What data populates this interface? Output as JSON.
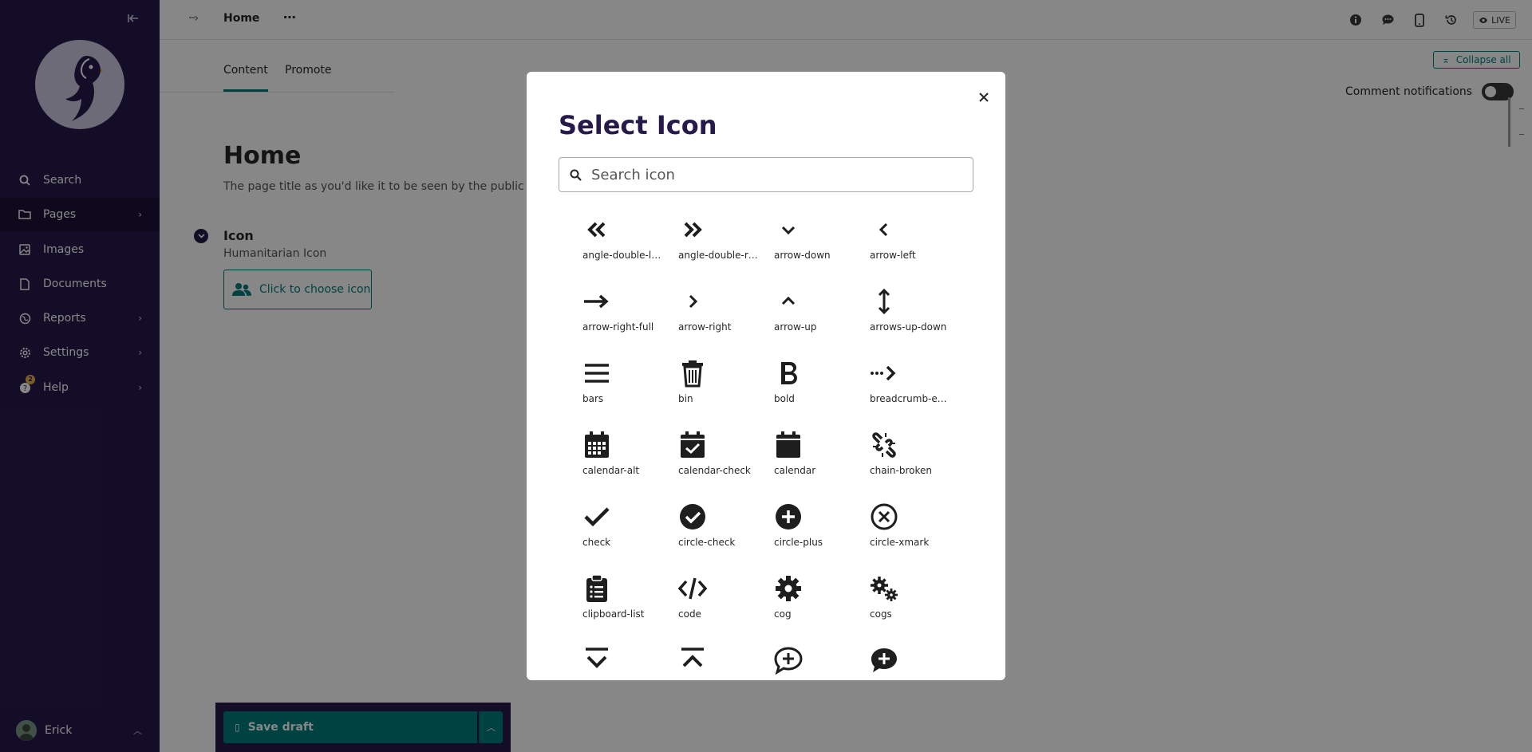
{
  "sidebar": {
    "collapse_icon": "collapse-left-icon",
    "items": [
      {
        "label": "Search",
        "icon": "search-icon",
        "has_children": false
      },
      {
        "label": "Pages",
        "icon": "folder-icon",
        "has_children": true
      },
      {
        "label": "Images",
        "icon": "image-icon",
        "has_children": false
      },
      {
        "label": "Documents",
        "icon": "doc-icon",
        "has_children": false
      },
      {
        "label": "Reports",
        "icon": "globe-icon",
        "has_children": true
      },
      {
        "label": "Settings",
        "icon": "cog-icon",
        "has_children": true
      },
      {
        "label": "Help",
        "icon": "help-icon",
        "has_children": true,
        "badge": "2"
      }
    ],
    "user": {
      "name": "Erick"
    }
  },
  "header": {
    "breadcrumb_title": "Home",
    "more": "⋯",
    "live_label": "LIVE"
  },
  "tabs": [
    {
      "label": "Content",
      "active": true
    },
    {
      "label": "Promote",
      "active": false
    }
  ],
  "panel": {
    "collapse_all_label": "Collapse all",
    "comment_notifications_label": "Comment notifications",
    "comment_notifications_on": false
  },
  "form": {
    "title_value": "Home",
    "title_help": "The page title as you'd like it to be seen by the public",
    "icon_field_label": "Icon",
    "icon_field_help": "Humanitarian Icon",
    "choose_icon_label": "Click to choose icon"
  },
  "footer": {
    "save_draft_label": "Save draft"
  },
  "modal": {
    "title": "Select Icon",
    "search_placeholder": "Search icon",
    "icons": [
      {
        "name": "angle-double-left",
        "label": "angle-double-left"
      },
      {
        "name": "angle-double-right",
        "label": "angle-double-ri…"
      },
      {
        "name": "arrow-down",
        "label": "arrow-down"
      },
      {
        "name": "arrow-left",
        "label": "arrow-left"
      },
      {
        "name": "arrow-right-full",
        "label": "arrow-right-full"
      },
      {
        "name": "arrow-right",
        "label": "arrow-right"
      },
      {
        "name": "arrow-up",
        "label": "arrow-up"
      },
      {
        "name": "arrows-up-down",
        "label": "arrows-up-down"
      },
      {
        "name": "bars",
        "label": "bars"
      },
      {
        "name": "bin",
        "label": "bin"
      },
      {
        "name": "bold",
        "label": "bold"
      },
      {
        "name": "breadcrumb-expand",
        "label": "breadcrumb-ex…"
      },
      {
        "name": "calendar-alt",
        "label": "calendar-alt"
      },
      {
        "name": "calendar-check",
        "label": "calendar-check"
      },
      {
        "name": "calendar",
        "label": "calendar"
      },
      {
        "name": "chain-broken",
        "label": "chain-broken"
      },
      {
        "name": "check",
        "label": "check"
      },
      {
        "name": "circle-check",
        "label": "circle-check"
      },
      {
        "name": "circle-plus",
        "label": "circle-plus"
      },
      {
        "name": "circle-xmark",
        "label": "circle-xmark"
      },
      {
        "name": "clipboard-list",
        "label": "clipboard-list"
      },
      {
        "name": "code",
        "label": "code"
      },
      {
        "name": "cog",
        "label": "cog"
      },
      {
        "name": "cogs",
        "label": "cogs"
      },
      {
        "name": "collapse-down",
        "label": ""
      },
      {
        "name": "collapse-up",
        "label": ""
      },
      {
        "name": "comment-add",
        "label": ""
      },
      {
        "name": "comment-add-reversed",
        "label": ""
      }
    ]
  }
}
